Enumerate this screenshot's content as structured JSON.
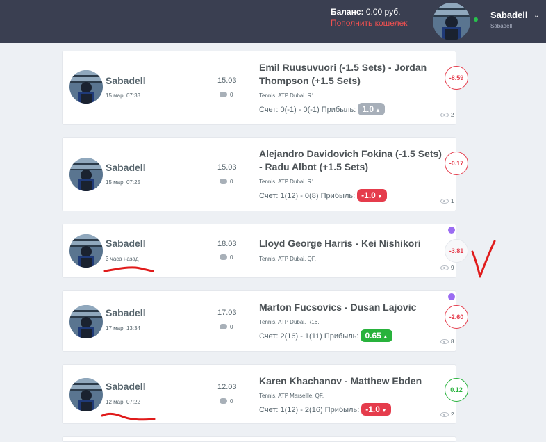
{
  "header": {
    "balance_label": "Баланс:",
    "balance_value": "0.00 руб.",
    "topup_link": "Пополнить кошелек",
    "user_name": "Sabadell",
    "user_sub": "Sabadell",
    "online_color": "#27c24c"
  },
  "colors": {
    "negative": "#e53c4c",
    "positive": "#28b23c",
    "neutral": "#a7afb9",
    "unread_dot": "#9b6cf2",
    "annotation": "#e01b1b"
  },
  "score_label": "Счет:",
  "profit_label": "Прибыль:",
  "cards": [
    {
      "user": "Sabadell",
      "time": "15 мар. 07:33",
      "date": "15.03",
      "comments": "0",
      "event": "Emil Ruusuvuori (-1.5 Sets) - Jordan Thompson (+1.5 Sets)",
      "info": "Tennis. ATP Dubai. R1.",
      "score": "0(-1) - 0(-1)",
      "profit": "1.0",
      "profit_status": "neutral",
      "rating": "-8.59",
      "views": "2"
    },
    {
      "user": "Sabadell",
      "time": "15 мар. 07:25",
      "date": "15.03",
      "comments": "0",
      "event": "Alejandro Davidovich Fokina (-1.5 Sets) - Radu Albot (+1.5 Sets)",
      "info": "Tennis. ATP Dubai. R1.",
      "score": "1(12) - 0(8)",
      "profit": "-1.0",
      "profit_status": "neg",
      "rating": "-0.17",
      "views": "1"
    },
    {
      "user": "Sabadell",
      "time": "3 часа назад",
      "date": "18.03",
      "comments": "0",
      "event": "Lloyd George Harris - Kei Nishikori",
      "info": "Tennis. ATP Dubai. QF.",
      "rating": "-3.81",
      "views": "9"
    },
    {
      "user": "Sabadell",
      "time": "17 мар. 13:34",
      "date": "17.03",
      "comments": "0",
      "event": "Marton Fucsovics - Dusan Lajovic",
      "info": "Tennis. ATP Dubai. R16.",
      "score": "2(16) - 1(11)",
      "profit": "0.65",
      "profit_status": "pos",
      "rating": "-2.60",
      "views": "8"
    },
    {
      "user": "Sabadell",
      "time": "12 мар. 07:22",
      "date": "12.03",
      "comments": "0",
      "event": "Karen Khachanov - Matthew Ebden",
      "info": "Tennis. ATP Marseille. QF.",
      "score": "1(12) - 2(16)",
      "profit": "-1.0",
      "profit_status": "neg",
      "rating": "0.12",
      "views": "2"
    }
  ]
}
